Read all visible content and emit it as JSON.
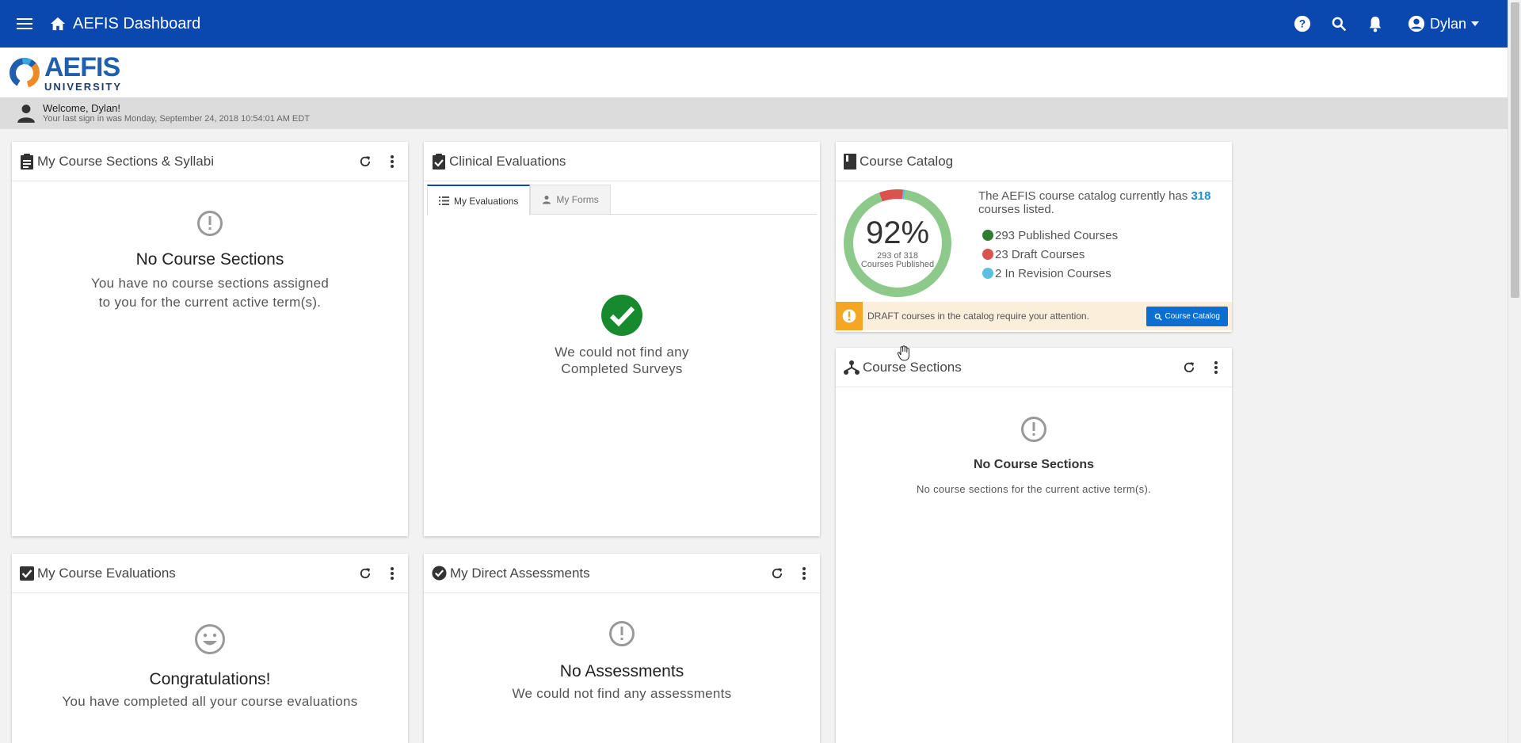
{
  "topbar": {
    "title": "AEFIS Dashboard",
    "user_name": "Dylan"
  },
  "logo": {
    "name": "AEFIS",
    "sub": "UNIVERSITY"
  },
  "welcome": {
    "title": "Welcome, Dylan!",
    "last_sign_in": "Your last sign in was Monday, September 24, 2018 10:54:01 AM EDT"
  },
  "course_sections_syllabi": {
    "title": "My Course Sections & Syllabi",
    "empty_title": "No Course Sections",
    "empty_text_line1": "You have no course sections assigned",
    "empty_text_line2": "to you for the current active term(s)."
  },
  "clinical_evaluations": {
    "title": "Clinical Evaluations",
    "tabs": [
      {
        "label": "My Evaluations"
      },
      {
        "label": "My Forms"
      }
    ],
    "empty_line1": "We could not find any",
    "empty_line2": "Completed Surveys"
  },
  "course_catalog": {
    "title": "Course Catalog",
    "percent": "92%",
    "donut_sub_line1": "293 of 318",
    "donut_sub_line2": "Courses Published",
    "info_prefix": "The AEFIS course catalog currently has",
    "total": "318",
    "info_suffix": "courses listed.",
    "legend": [
      {
        "label": "293 Published Courses",
        "value": 293,
        "color": "#2e7d32"
      },
      {
        "label": "23 Draft Courses",
        "value": 23,
        "color": "#d9534f"
      },
      {
        "label": "2 In Revision Courses",
        "value": 2,
        "color": "#5bc0de"
      }
    ],
    "alert_text": "DRAFT courses in the catalog require your attention.",
    "alert_button": "Course Catalog"
  },
  "course_sections": {
    "title": "Course Sections",
    "empty_title": "No Course Sections",
    "empty_text": "No course sections for the current active term(s)."
  },
  "course_evaluations": {
    "title": "My Course Evaluations",
    "empty_title": "Congratulations!",
    "empty_text": "You have completed all your course evaluations"
  },
  "direct_assessments": {
    "title": "My Direct Assessments",
    "empty_title": "No Assessments",
    "empty_text": "We could not find any assessments"
  },
  "colors": {
    "topbar": "#0a47ae",
    "accent": "#1b8fd3",
    "success": "#178a2d",
    "warning": "#f5a623"
  }
}
